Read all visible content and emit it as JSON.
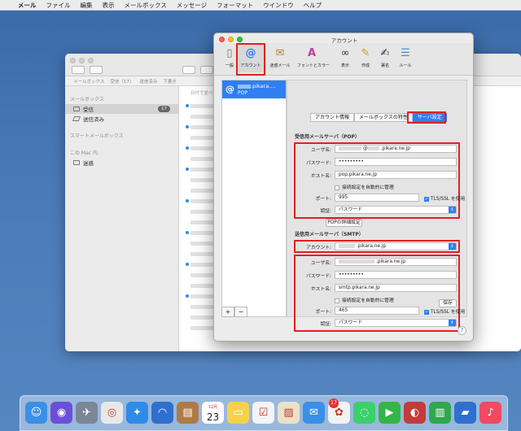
{
  "menubar": {
    "apple": "",
    "app": "メール",
    "items": [
      "ファイル",
      "編集",
      "表示",
      "メールボックス",
      "メッセージ",
      "フォーマット",
      "ウインドウ",
      "ヘルプ"
    ]
  },
  "mail": {
    "favorites": [
      "メールボックス",
      "受信（17）",
      "送信済み",
      "下書き"
    ],
    "sidebar": {
      "section_mailboxes": "メールボックス",
      "inbox": "受信",
      "inbox_count": "17",
      "sent": "送信済み",
      "section_smart": "スマートメールボックス",
      "section_mac": "この Mac 内",
      "junk": "迷惑"
    },
    "list_header": "日付で並べ替え"
  },
  "account_window": {
    "title": "アカウント",
    "toolbar": [
      "一般",
      "アカウント",
      "迷惑メール",
      "フォントとカラー",
      "表示",
      "作成",
      "署名",
      "ルール"
    ],
    "toolbar_icons": [
      "switch-icon",
      "at-icon",
      "junk-icon",
      "font-color-icon",
      "glasses-icon",
      "compose-icon",
      "signature-icon",
      "rules-icon"
    ],
    "account": {
      "name_suffix": ".pikara....",
      "type": "POP"
    },
    "add_label": "+",
    "remove_label": "−",
    "tabs": [
      "アカウント情報",
      "メールボックスの特性",
      "サーバ設定"
    ],
    "incoming": {
      "heading": "受信用メールサーバ（POP）",
      "user_label": "ユーザ名:",
      "user_value": "@",
      "user_domain": ".pikara.ne.jp",
      "password_label": "パスワード:",
      "password_value": "•••••••••",
      "host_label": "ホスト名:",
      "host_value": "pop.pikara.ne.jp",
      "auto_manage": "接続設定を自動的に管理",
      "port_label": "ポート:",
      "port_value": "995",
      "tls": "TLS/SSL を使用",
      "auth_label": "認証:",
      "auth_value": "パスワード",
      "details_button": "POPの詳細設定"
    },
    "outgoing": {
      "heading": "送信用メールサーバ（SMTP）",
      "account_label": "アカウント:",
      "account_value": ".pikara.ne.jp",
      "user_label": "ユーザ名:",
      "user_value": ".pikara.ne.jp",
      "password_label": "パスワード:",
      "password_value": "•••••••••",
      "host_label": "ホスト名:",
      "host_value": "smtp.pikara.ne.jp",
      "auto_manage": "接続設定を自動的に管理",
      "port_label": "ポート:",
      "port_value": "465",
      "tls": "TLS/SSL を使用",
      "auth_label": "認証:",
      "auth_value": "パスワード"
    },
    "save_button": "保存",
    "help": "?"
  },
  "dock": {
    "calendar_month": "12月",
    "calendar_day": "23",
    "mail_badge": "17"
  },
  "colors": {
    "accent": "#2f7ff2",
    "highlight_box": "#e02020",
    "desktop": "#4a7bb8"
  }
}
